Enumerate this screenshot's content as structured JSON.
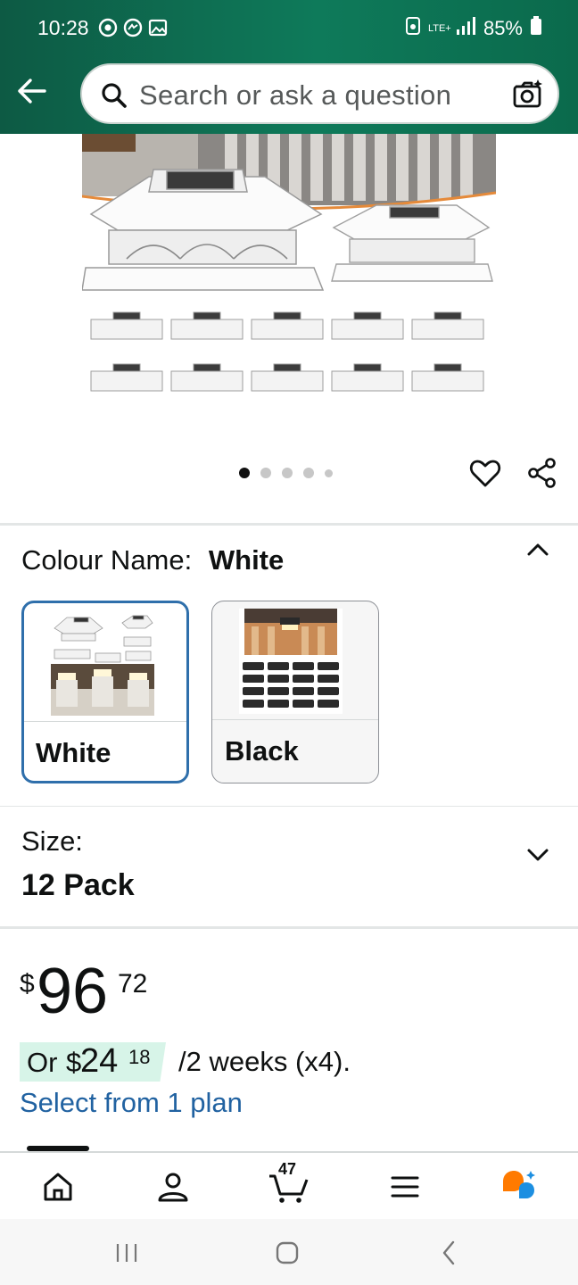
{
  "status_bar": {
    "time": "10:28",
    "network": "LTE+",
    "battery": "85%"
  },
  "search": {
    "placeholder": "Search or ask a question"
  },
  "carousel": {
    "dot_count": 5,
    "active_index": 0
  },
  "colour": {
    "label": "Colour Name:",
    "selected": "White",
    "options": [
      "White",
      "Black"
    ]
  },
  "size": {
    "label": "Size:",
    "value": "12 Pack"
  },
  "price": {
    "symbol": "$",
    "whole": "96",
    "fraction": "72"
  },
  "installment": {
    "prefix": "Or",
    "symbol": "$",
    "whole": "24",
    "fraction": "18",
    "suffix": "/2 weeks (x4).",
    "link": "Select from 1 plan"
  },
  "bottom_nav": {
    "items": [
      "home-icon",
      "account-icon",
      "cart-icon",
      "menu-icon",
      "rufus-icon"
    ],
    "cart_count": "47"
  },
  "colors": {
    "header": "#0e7a5a",
    "link": "#2162a1",
    "selected_border": "#2f6fab",
    "plan_highlight": "#d7f4e8"
  }
}
